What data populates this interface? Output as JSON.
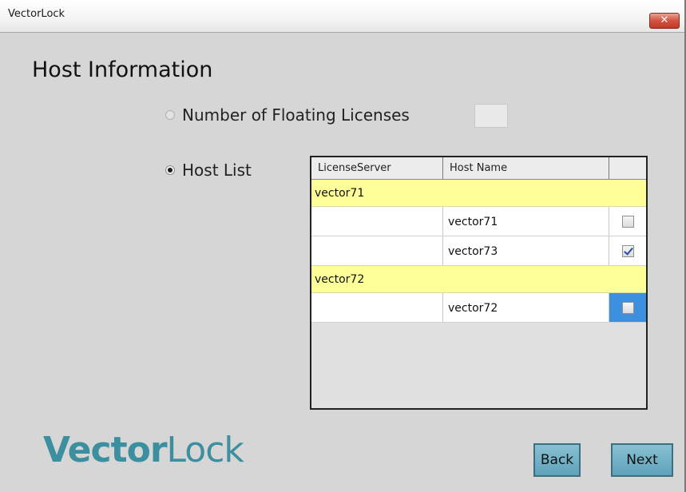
{
  "window": {
    "title": "VectorLock",
    "close_label": "✕"
  },
  "page": {
    "heading": "Host Information"
  },
  "options": {
    "floating": {
      "label": "Number of Floating Licenses",
      "selected": false,
      "value": ""
    },
    "host_list": {
      "label": "Host List",
      "selected": true
    }
  },
  "table": {
    "columns": [
      "LicenseServer",
      "Host Name",
      ""
    ],
    "groups": [
      {
        "server": "vector71",
        "hosts": [
          {
            "name": "vector71",
            "checked": false
          },
          {
            "name": "vector73",
            "checked": true
          }
        ]
      },
      {
        "server": "vector72",
        "hosts": [
          {
            "name": "vector72",
            "checked": false,
            "selected": true
          }
        ]
      }
    ]
  },
  "logo": {
    "text_bold": "Vector",
    "text_thin": "Lock"
  },
  "buttons": {
    "back": "Back",
    "next": "Next"
  },
  "colors": {
    "accent": "#5ea3bb",
    "group_row": "#ffff99",
    "logo": "#3c8f9e",
    "selection": "#3d8fe0"
  }
}
